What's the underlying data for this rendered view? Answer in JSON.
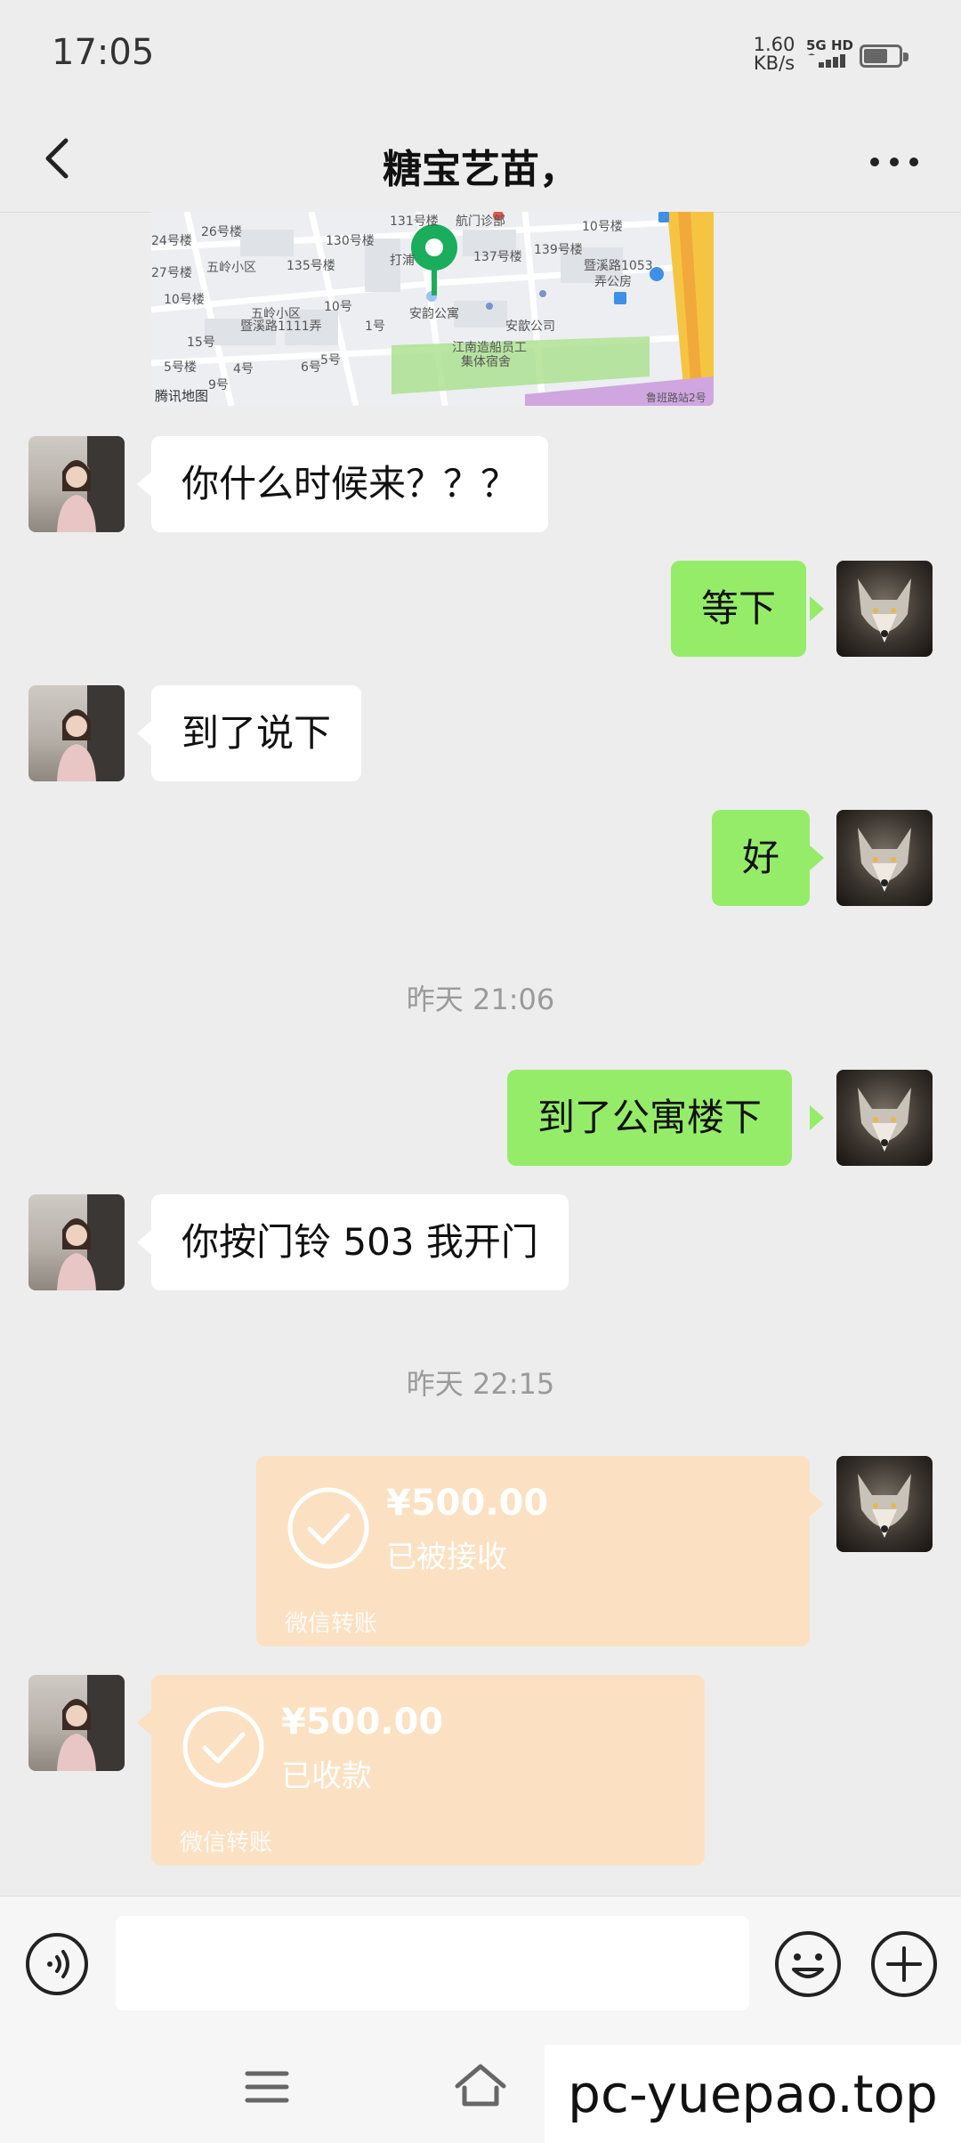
{
  "status_bar": {
    "time": "17:05",
    "net_speed_value": "1.60",
    "net_speed_unit": "KB/s",
    "network": "5G HD"
  },
  "header": {
    "title": "糖宝艺苗，",
    "back_icon": "chevron-left-icon",
    "more_icon": "more-dots-icon"
  },
  "map": {
    "labels": [
      "131号楼",
      "航门诊部",
      "10号楼",
      "26号楼",
      "130号楼",
      "24号楼",
      "五岭小区",
      "27号楼",
      "打浦",
      "135号楼",
      "137号楼",
      "139号楼",
      "暨溪路1053",
      "弄公房",
      "10号楼",
      "五岭小区",
      "暨溪路1111弄",
      "10号",
      "1号",
      "安韵公寓",
      "安歆公司",
      "江南造船员工",
      "集体宿舍",
      "15号",
      "5号楼",
      "4号",
      "6号",
      "5号",
      "9号",
      "腾讯地图",
      "鲁班路站2号"
    ]
  },
  "messages": [
    {
      "side": "left",
      "text": "你什么时候来？？？"
    },
    {
      "side": "right",
      "text": "等下"
    },
    {
      "side": "left",
      "text": "到了说下"
    },
    {
      "side": "right",
      "text": "好"
    },
    {
      "type": "timestamp",
      "text": "昨天 21:06"
    },
    {
      "side": "right",
      "text": "到了公寓楼下"
    },
    {
      "side": "left",
      "text": "你按门铃 503 我开门"
    },
    {
      "type": "timestamp",
      "text": "昨天 22:15"
    },
    {
      "side": "right",
      "type": "transfer",
      "amount": "¥500.00",
      "status": "已被接收",
      "brand": "微信转账"
    },
    {
      "side": "left",
      "type": "transfer",
      "amount": "¥500.00",
      "status": "已收款",
      "brand": "微信转账"
    }
  ],
  "input_bar": {
    "voice_icon": "voice-icon",
    "emoji_icon": "emoji-icon",
    "plus_icon": "plus-icon",
    "value": ""
  },
  "nav": {
    "menu_icon": "menu-icon",
    "home_icon": "home-icon"
  },
  "watermark": "pc-yuepao.top",
  "colors": {
    "background": "#ededed",
    "bubble_self": "#95ec69",
    "bubble_other": "#ffffff",
    "transfer_card": "#fbe1c2",
    "map_pin": "#1aad5b"
  }
}
